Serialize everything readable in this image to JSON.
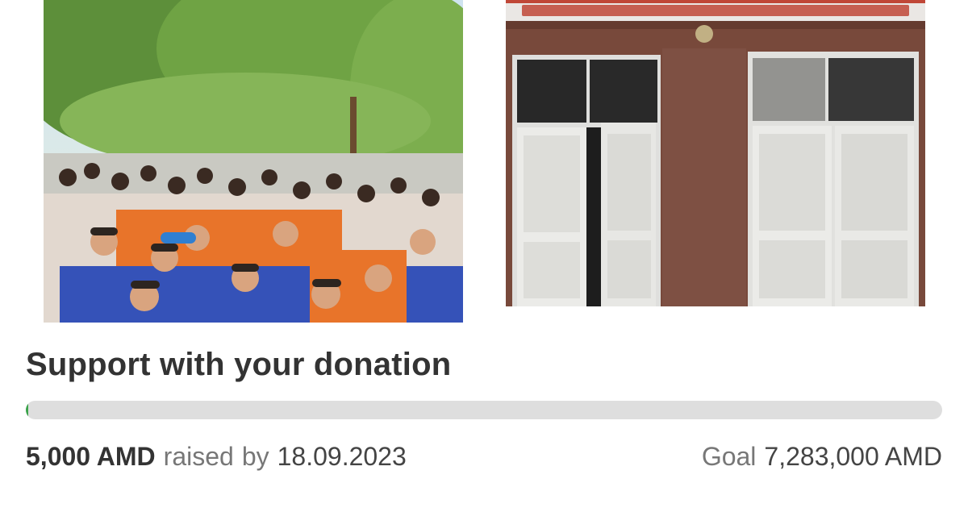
{
  "campaign": {
    "title": "Support with your donation",
    "progress_fraction": 0.0007,
    "raised_amount": "5,000 AMD",
    "raised_label": "raised",
    "by_label": "by",
    "date": "18.09.2023",
    "goal_label": "Goal",
    "goal_amount": "7,283,000 AMD"
  },
  "colors": {
    "progress_fill": "#3aa34a",
    "progress_track": "#dedede",
    "title": "#333333",
    "muted": "#777777"
  }
}
